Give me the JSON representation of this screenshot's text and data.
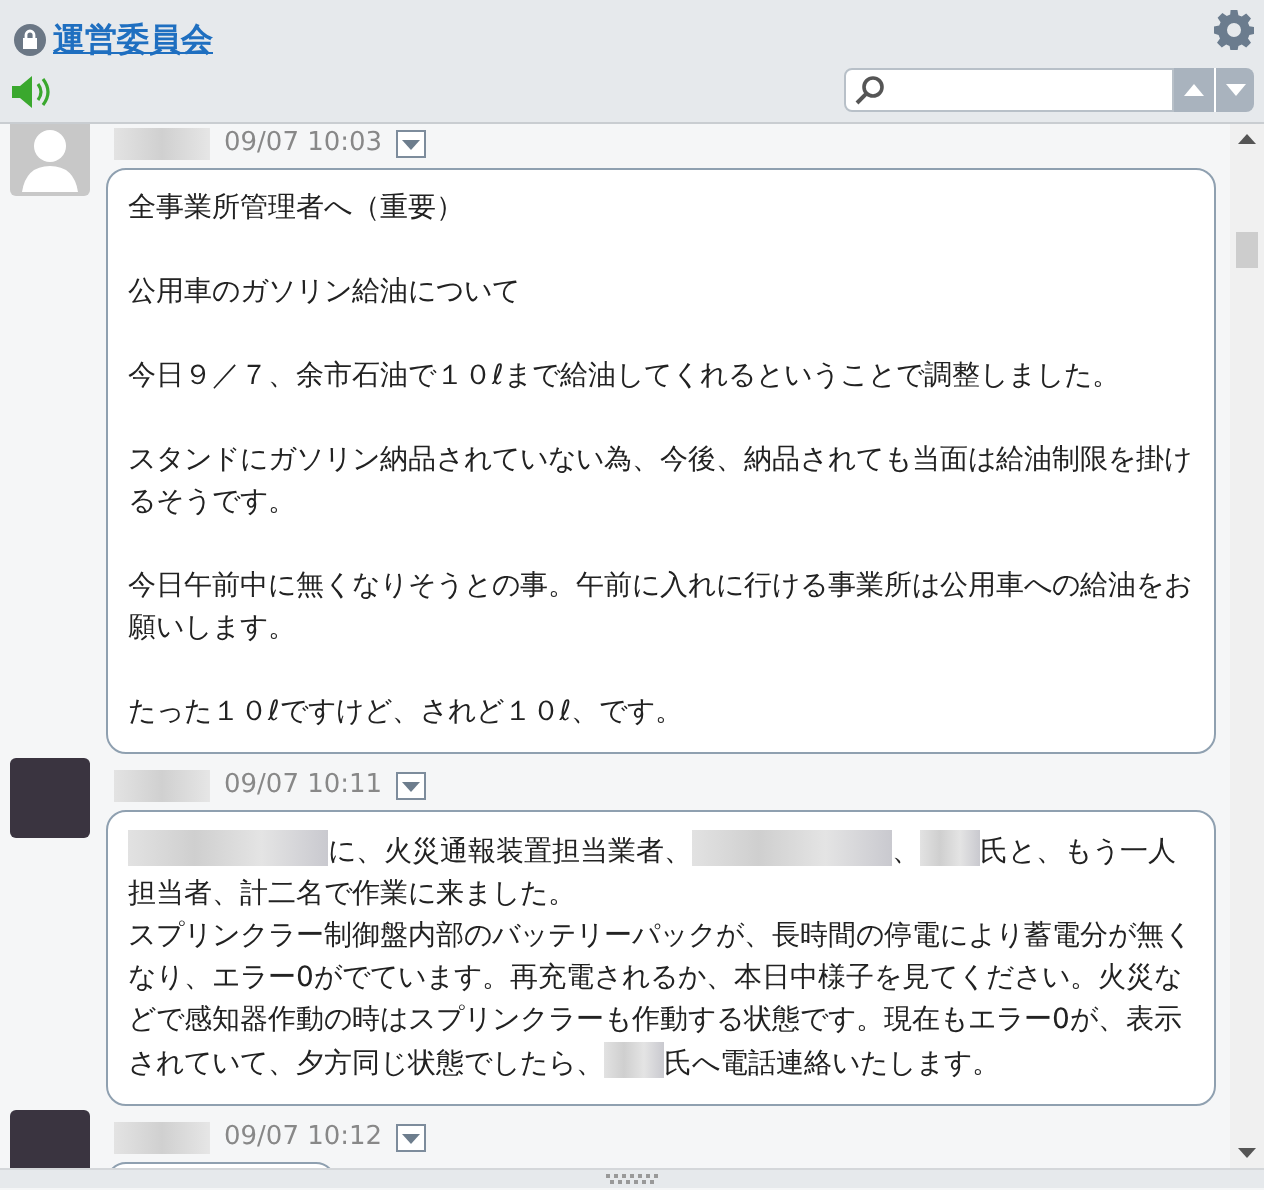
{
  "header": {
    "title": "運営委員会",
    "locked": true,
    "sound_on": true
  },
  "messages": [
    {
      "kind": "silhouette",
      "time": "09/07 10:03",
      "blank_lines": true,
      "paragraphs": [
        [
          {
            "kind": "text",
            "text": "全事業所管理者へ（重要）"
          }
        ],
        [
          {
            "kind": "text",
            "text": "公用車のガソリン給油について"
          }
        ],
        [
          {
            "kind": "text",
            "text": "今日９／７、余市石油で１０ℓまで給油してくれるということで調整しました。"
          }
        ],
        [
          {
            "kind": "text",
            "text": "スタンドにガソリン納品されていない為、今後、納品されても当面は給油制限を掛けるそうです。"
          }
        ],
        [
          {
            "kind": "text",
            "text": "今日午前中に無くなりそうとの事。午前に入れに行ける事業所は公用車への給油をお願いします。"
          }
        ],
        [
          {
            "kind": "text",
            "text": "たった１０ℓですけど、されど１０ℓ、です。"
          }
        ]
      ]
    },
    {
      "kind": "photo",
      "time": "09/07 10:11",
      "blank_lines": false,
      "paragraphs": [
        [
          {
            "kind": "blur",
            "wide": true
          },
          {
            "kind": "text",
            "text": "に、火災通報装置担当業者、"
          },
          {
            "kind": "blur",
            "wide": true
          },
          {
            "kind": "text",
            "text": "、"
          },
          {
            "kind": "blur",
            "wide": false
          },
          {
            "kind": "text",
            "text": "氏と、もう一人担当者、計二名で作業に来ました。"
          }
        ],
        [
          {
            "kind": "text",
            "text": "スプリンクラー制御盤内部のバッテリーパックが、長時間の停電により蓄電分が無くなり、エラー0がでています。再充電されるか、本日中様子を見てください。火災などで感知器作動の時はスプリンクラーも作動する状態です。現在もエラー0が、表示されていて、夕方同じ状態でしたら、"
          },
          {
            "kind": "blur",
            "wide": false
          },
          {
            "kind": "text",
            "text": "氏へ電話連絡いたします。"
          }
        ]
      ]
    },
    {
      "kind": "photo",
      "time": "09/07 10:12"
    }
  ]
}
